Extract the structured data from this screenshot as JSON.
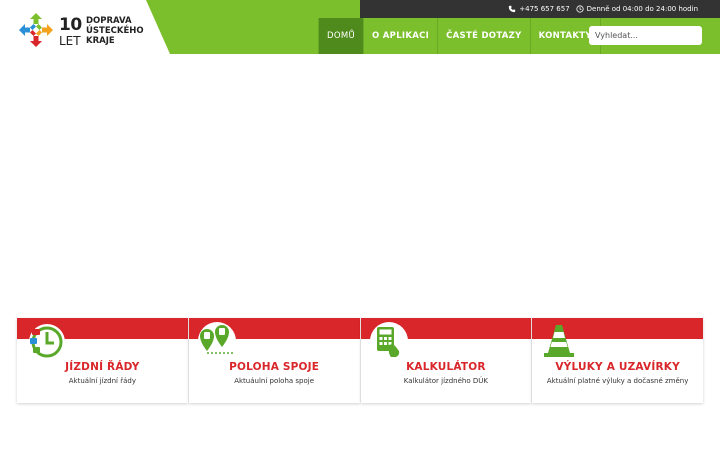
{
  "topbar": {
    "phone": "+475 657 657",
    "hours": "Denně od 04:00 do 24:00 hodin"
  },
  "logo": {
    "number": "10",
    "let": "LET",
    "line1": "DOPRAVA",
    "line2": "ÚSTECKÉHO",
    "line3": "KRAJE"
  },
  "nav": {
    "items": [
      {
        "label": "DOMŮ",
        "active": true
      },
      {
        "label": "O APLIKACI"
      },
      {
        "label": "ČASTÉ DOTAZY"
      },
      {
        "label": "KONTAKTY"
      }
    ]
  },
  "search": {
    "placeholder": "Vyhledat..."
  },
  "cards": [
    {
      "title": "JÍZDNÍ ŘÁDY",
      "subtitle": "Aktuální jízdní řády",
      "icon": "timetable-clock-icon"
    },
    {
      "title": "POLOHA SPOJE",
      "subtitle": "Aktuáulní poloha spoje",
      "icon": "vehicle-location-icon"
    },
    {
      "title": "KALKULÁTOR",
      "subtitle": "Kalkulátor jízdného DÚK",
      "icon": "calculator-icon"
    },
    {
      "title": "VÝLUKY A UZAVÍRKY",
      "subtitle": "Aktuální platné výluky a dočasné změny",
      "icon": "traffic-cone-icon"
    }
  ],
  "colors": {
    "green": "#7cbf2c",
    "green_active": "#4f8a1c",
    "red": "#d9262a",
    "dark": "#333333"
  }
}
